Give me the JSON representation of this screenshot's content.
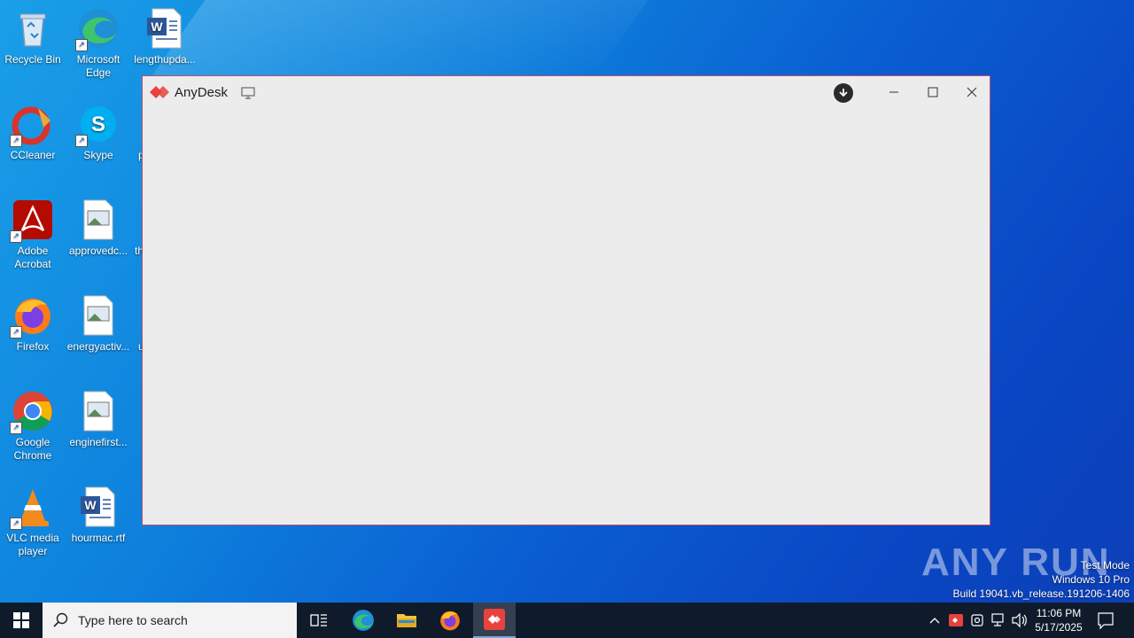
{
  "desktop": {
    "icons": [
      {
        "label": "Recycle Bin",
        "icon": "recycle-bin-icon"
      },
      {
        "label": "Microsoft Edge",
        "icon": "edge-icon"
      },
      {
        "label": "lengthupda...",
        "icon": "word-doc-icon"
      },
      {
        "label": "CCleaner",
        "icon": "ccleaner-icon"
      },
      {
        "label": "Skype",
        "icon": "skype-icon"
      },
      {
        "label": "Adobe Acrobat",
        "icon": "acrobat-icon"
      },
      {
        "label": "approvedc...",
        "icon": "image-file-icon"
      },
      {
        "label": "Firefox",
        "icon": "firefox-icon"
      },
      {
        "label": "energyactiv...",
        "icon": "image-file-icon"
      },
      {
        "label": "Google Chrome",
        "icon": "chrome-icon"
      },
      {
        "label": "enginefirst...",
        "icon": "image-file-icon"
      },
      {
        "label": "VLC media player",
        "icon": "vlc-icon"
      },
      {
        "label": "hourmac.rtf",
        "icon": "word-doc-icon"
      }
    ],
    "partial_labels": [
      "p",
      "th",
      "u"
    ]
  },
  "window": {
    "title": "AnyDesk",
    "accent": "#e8423f"
  },
  "watermark": {
    "text": "ANY RUN",
    "mode": "Test Mode",
    "edition": "Windows 10 Pro",
    "build": "Build 19041.vb_release.191206-1406"
  },
  "taskbar": {
    "search_placeholder": "Type here to search",
    "time": "11:06 PM",
    "date": "5/17/2025"
  }
}
